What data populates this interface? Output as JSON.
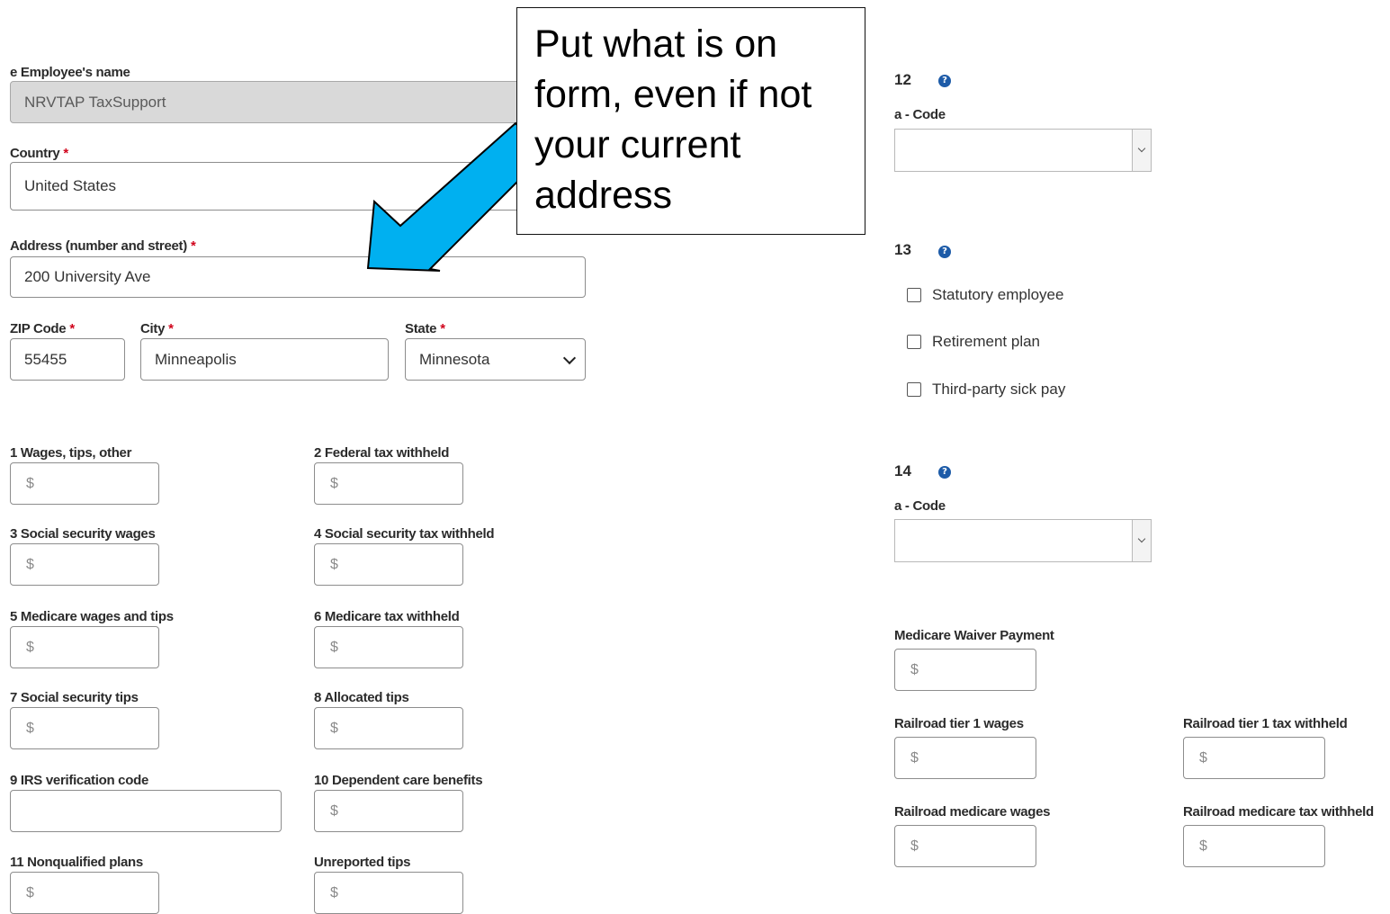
{
  "employee": {
    "name_label": "e Employee's name",
    "name_value": "NRVTAP TaxSupport",
    "country_label": "Country",
    "country_value": "United States",
    "address_label": "Address (number and street)",
    "address_value": "200 University Ave",
    "zip_label": "ZIP Code",
    "zip_value": "55455",
    "city_label": "City",
    "city_value": "Minneapolis",
    "state_label": "State",
    "state_value": "Minnesota",
    "required_mark": "*"
  },
  "boxes": {
    "dollar": "$",
    "b1": "1 Wages, tips, other",
    "b2": "2 Federal tax withheld",
    "b3": "3 Social security wages",
    "b4": "4 Social security tax withheld",
    "b5": "5 Medicare wages and tips",
    "b6": "6 Medicare tax withheld",
    "b7": "7 Social security tips",
    "b8": "8 Allocated tips",
    "b9": "9 IRS verification code",
    "b10": "10 Dependent care benefits",
    "b11": "11 Nonqualified plans",
    "unreported": "Unreported tips"
  },
  "right": {
    "box12": "12",
    "box13": "13",
    "box14": "14",
    "help": "?",
    "code_label_12": "a - Code",
    "code_label_14": "a - Code",
    "checkboxes": [
      "Statutory employee",
      "Retirement plan",
      "Third-party sick pay"
    ],
    "medicare_waiver": "Medicare Waiver Payment",
    "rr_tier1_wages": "Railroad tier 1 wages",
    "rr_tier1_tax": "Railroad tier 1 tax withheld",
    "rr_medicare_wages": "Railroad medicare wages",
    "rr_medicare_tax": "Railroad medicare tax withheld"
  },
  "callout": {
    "text": "Put what is on form, even if not your current address"
  },
  "colors": {
    "arrow_fill": "#00b0f0",
    "help_icon": "#1d5ba8",
    "required": "#d0021b"
  }
}
